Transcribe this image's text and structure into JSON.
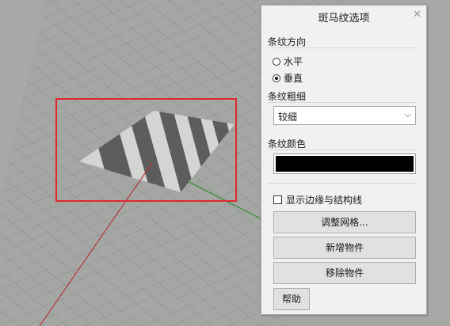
{
  "panel": {
    "title": "斑马纹选项",
    "close_icon": "close-icon",
    "stripe_direction": {
      "label": "条纹方向",
      "options": [
        {
          "label": "水平",
          "selected": false
        },
        {
          "label": "垂直",
          "selected": true
        }
      ]
    },
    "stripe_thickness": {
      "label": "条纹粗细",
      "value": "较细"
    },
    "stripe_color": {
      "label": "条纹颜色",
      "value": "#000000"
    },
    "show_edges": {
      "label": "显示边缘与结构线",
      "checked": false
    },
    "buttons": {
      "adjust_mesh": "调整网格...",
      "add_objects": "新增物件",
      "remove_objects": "移除物件",
      "help": "帮助"
    }
  },
  "viewport": {
    "grid_color": "#8d918e",
    "selection_color": "#e0282e"
  }
}
